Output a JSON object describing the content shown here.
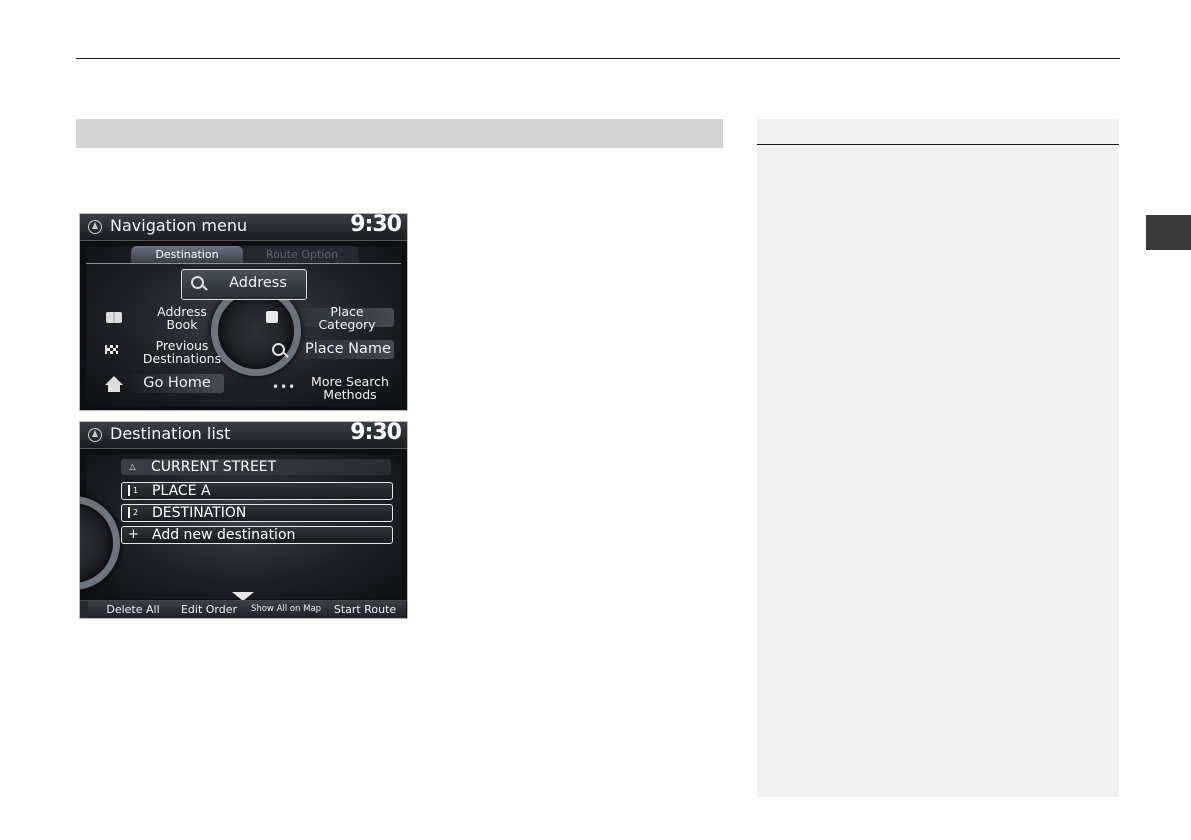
{
  "nav_menu": {
    "title": "Navigation menu",
    "time": "9:30",
    "tabs": [
      {
        "label": "Destination",
        "active": true
      },
      {
        "label": "Route Option",
        "active": false
      }
    ],
    "items": {
      "address": "Address",
      "address_book": "Address\nBook",
      "previous_destinations": "Previous\nDestinations",
      "go_home": "Go Home",
      "place_category": "Place\nCategory",
      "place_name": "Place Name",
      "more_search": "More Search\nMethods"
    },
    "icons": {
      "address": "magnifier-map-icon",
      "address_book": "book-icon",
      "previous_destinations": "checkered-flag-icon",
      "go_home": "house-icon",
      "place_category": "shopping-bag-icon",
      "place_name": "magnifier-icon",
      "more_search": "dots-icon"
    }
  },
  "dest_list": {
    "title": "Destination list",
    "time": "9:30",
    "rows": [
      {
        "icon": "△",
        "label": "CURRENT STREET"
      },
      {
        "icon": "1",
        "label": "PLACE A"
      },
      {
        "icon": "2",
        "label": "DESTINATION"
      },
      {
        "icon": "+",
        "label": "Add new destination"
      }
    ],
    "footer": {
      "delete_all": "Delete All",
      "edit_order": "Edit Order",
      "show_all": "Show All on Map",
      "start_route": "Start Route"
    }
  }
}
